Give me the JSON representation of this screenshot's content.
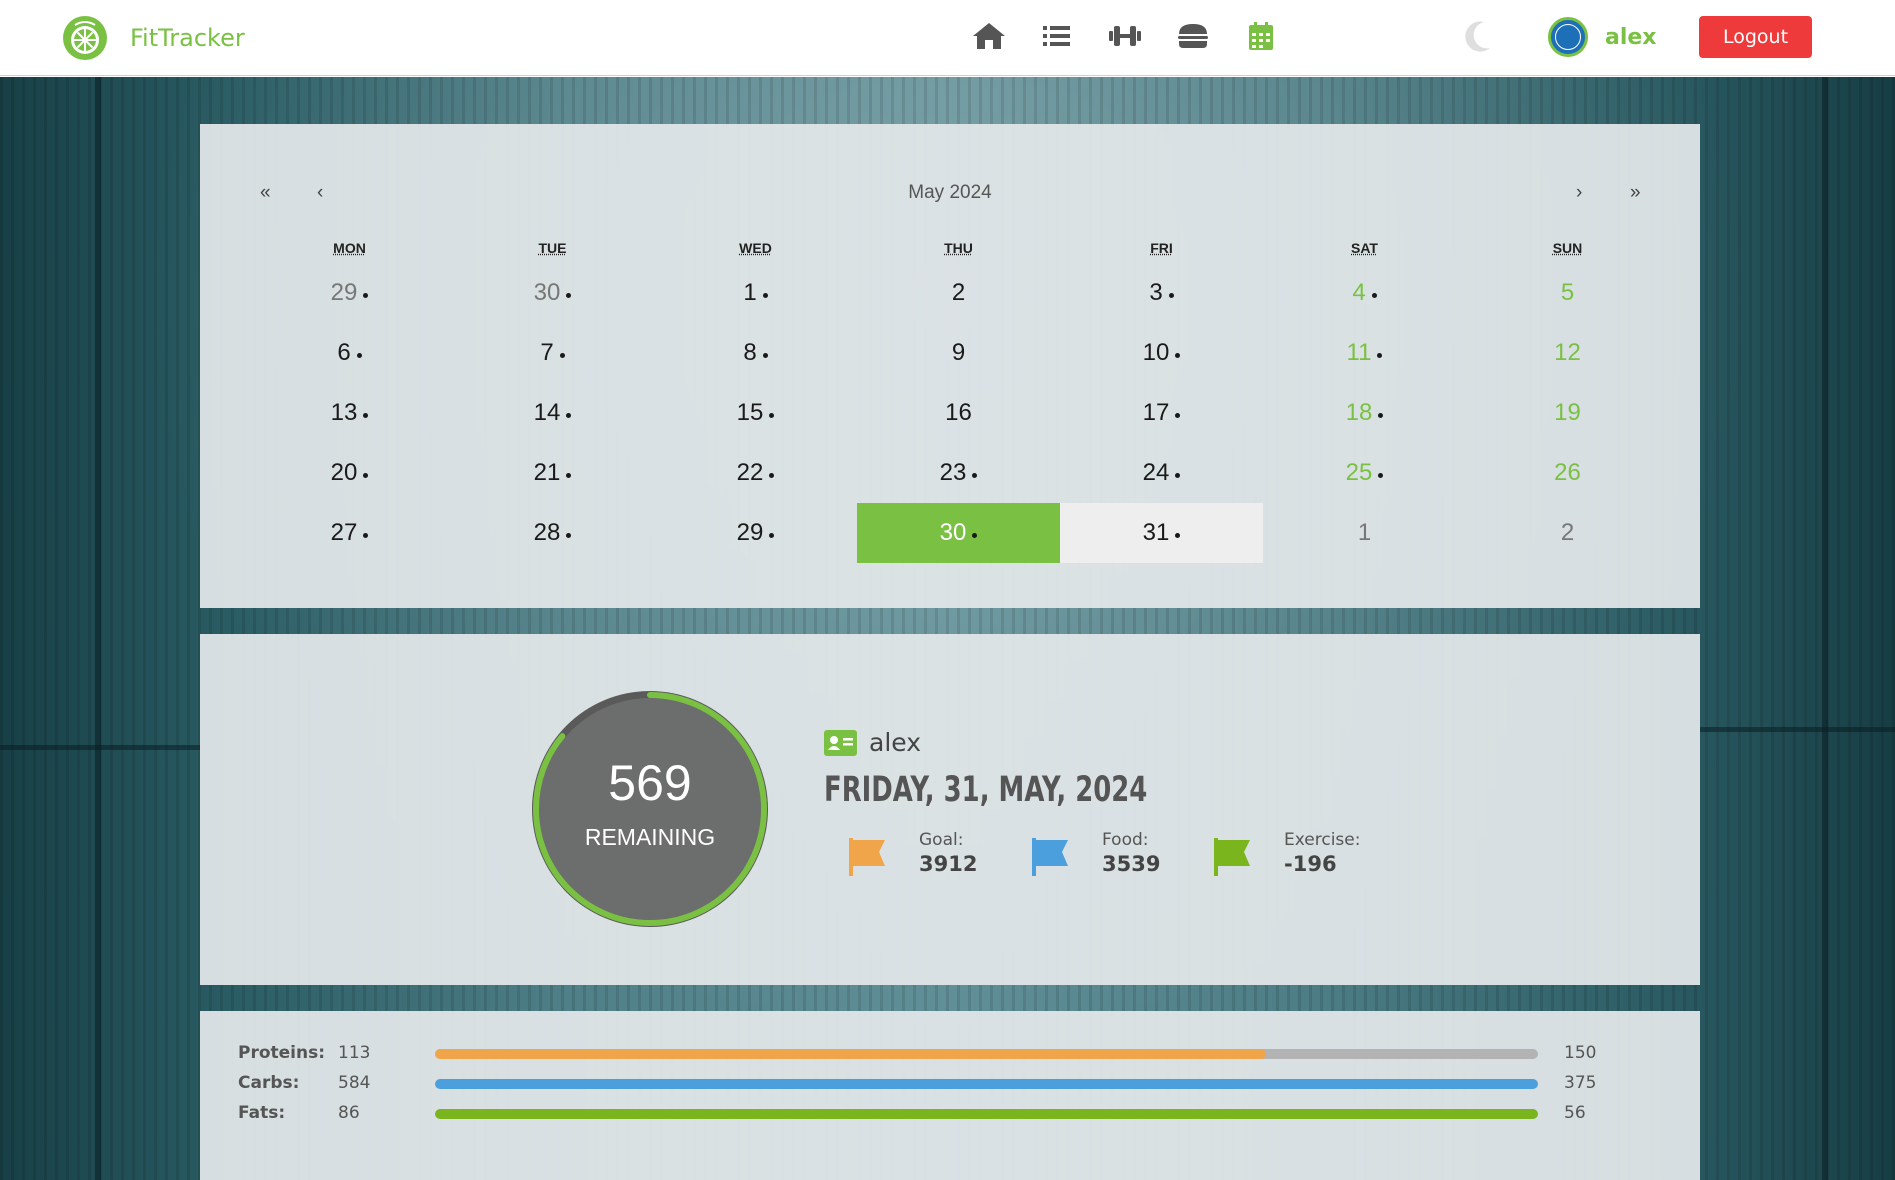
{
  "navbar": {
    "brand_name": "FitTracker",
    "nav_icons": [
      "home-icon",
      "list-icon",
      "dumbbell-icon",
      "burger-icon",
      "calendar-icon"
    ],
    "active_icon": "calendar-icon",
    "theme_icon": "moon-icon",
    "username": "alex",
    "logout_label": "Logout"
  },
  "calendar": {
    "title": "May 2024",
    "nav": {
      "prev_year": "«",
      "prev_month": "‹",
      "next_month": "›",
      "next_year": "»"
    },
    "weekdays": [
      "MON",
      "TUE",
      "WED",
      "THU",
      "FRI",
      "SAT",
      "SUN"
    ],
    "days": [
      {
        "label": "29",
        "dot": true,
        "kind": "muted"
      },
      {
        "label": "30",
        "dot": true,
        "kind": "muted"
      },
      {
        "label": "1",
        "dot": true,
        "kind": "normal"
      },
      {
        "label": "2",
        "dot": false,
        "kind": "normal"
      },
      {
        "label": "3",
        "dot": true,
        "kind": "normal"
      },
      {
        "label": "4",
        "dot": true,
        "kind": "weekend"
      },
      {
        "label": "5",
        "dot": false,
        "kind": "weekend"
      },
      {
        "label": "6",
        "dot": true,
        "kind": "normal"
      },
      {
        "label": "7",
        "dot": true,
        "kind": "normal"
      },
      {
        "label": "8",
        "dot": true,
        "kind": "normal"
      },
      {
        "label": "9",
        "dot": false,
        "kind": "normal"
      },
      {
        "label": "10",
        "dot": true,
        "kind": "normal"
      },
      {
        "label": "11",
        "dot": true,
        "kind": "weekend"
      },
      {
        "label": "12",
        "dot": false,
        "kind": "weekend"
      },
      {
        "label": "13",
        "dot": true,
        "kind": "normal"
      },
      {
        "label": "14",
        "dot": true,
        "kind": "normal"
      },
      {
        "label": "15",
        "dot": true,
        "kind": "normal"
      },
      {
        "label": "16",
        "dot": false,
        "kind": "normal"
      },
      {
        "label": "17",
        "dot": true,
        "kind": "normal"
      },
      {
        "label": "18",
        "dot": true,
        "kind": "weekend"
      },
      {
        "label": "19",
        "dot": false,
        "kind": "weekend"
      },
      {
        "label": "20",
        "dot": true,
        "kind": "normal"
      },
      {
        "label": "21",
        "dot": true,
        "kind": "normal"
      },
      {
        "label": "22",
        "dot": true,
        "kind": "normal"
      },
      {
        "label": "23",
        "dot": true,
        "kind": "normal"
      },
      {
        "label": "24",
        "dot": true,
        "kind": "normal"
      },
      {
        "label": "25",
        "dot": true,
        "kind": "weekend"
      },
      {
        "label": "26",
        "dot": false,
        "kind": "weekend"
      },
      {
        "label": "27",
        "dot": true,
        "kind": "normal"
      },
      {
        "label": "28",
        "dot": true,
        "kind": "normal"
      },
      {
        "label": "29",
        "dot": true,
        "kind": "normal"
      },
      {
        "label": "30",
        "dot": true,
        "kind": "today"
      },
      {
        "label": "31",
        "dot": true,
        "kind": "selected"
      },
      {
        "label": "1",
        "dot": false,
        "kind": "muted"
      },
      {
        "label": "2",
        "dot": false,
        "kind": "muted"
      }
    ]
  },
  "summary": {
    "remaining_value": "569",
    "remaining_label": "REMAINING",
    "ring_progress": 0.86,
    "user_icon": "id-card-icon",
    "username": "alex",
    "date": "FRIDAY, 31, MAY, 2024",
    "stats": [
      {
        "label": "Goal:",
        "value": "3912",
        "color": "#f0a54a",
        "icon": "flag-icon"
      },
      {
        "label": "Food:",
        "value": "3539",
        "color": "#4a9fdc",
        "icon": "flag-icon"
      },
      {
        "label": "Exercise:",
        "value": "-196",
        "color": "#7ab51d",
        "icon": "flag-icon"
      }
    ]
  },
  "macros": [
    {
      "label": "Proteins:",
      "value": "113",
      "goal": "150",
      "color": "#f0a54a",
      "progress": 0.7533
    },
    {
      "label": "Carbs:",
      "value": "584",
      "goal": "375",
      "color": "#4a9fdc",
      "progress": 1.0
    },
    {
      "label": "Fats:",
      "value": "86",
      "goal": "56",
      "color": "#7ab51d",
      "progress": 1.0
    }
  ],
  "colors": {
    "accent": "#7ac143",
    "logout": "#ee3a3a",
    "ring_dark": "#666666"
  }
}
